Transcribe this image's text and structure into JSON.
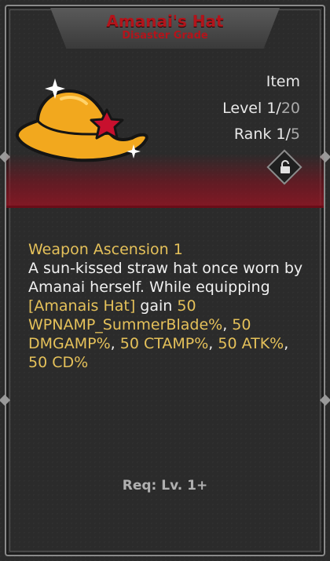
{
  "item": {
    "name": "Amanai's Hat",
    "grade": "Disaster Grade",
    "type_label": "Item",
    "level_label": "Level 1/",
    "level_max": "20",
    "rank_label": "Rank 1/",
    "rank_max": "5"
  },
  "description": {
    "heading": "Weapon Ascension 1",
    "text_1": "A sun-kissed straw hat once worn by Amanai herself. While equipping ",
    "item_ref": "[Amanais Hat]",
    "text_2": " gain ",
    "v1": "50 WPNAMP_SummerBlade%",
    "sep1": ", ",
    "v2": "50 DMGAMP%",
    "sep2": ", ",
    "v3": "50 CTAMP%",
    "sep3": ", ",
    "v4": "50 ATK%",
    "sep4": ", ",
    "v5": "50 CD%"
  },
  "requirement": "Req: Lv. 1+",
  "colors": {
    "title": "#b3141b",
    "highlight": "#e5c15a",
    "hat": "#f2a81e",
    "star": "#c8102e"
  },
  "icons": [
    "hat-icon",
    "star-emblem-icon",
    "sparkle-icon",
    "lock-icon"
  ]
}
